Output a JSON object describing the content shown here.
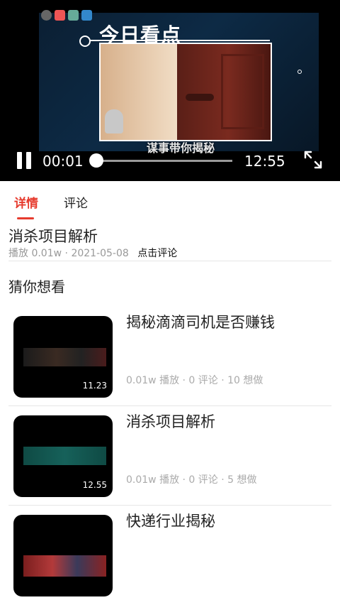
{
  "player": {
    "overlay_title": "今日看点",
    "subtitle": "谋事带你揭秘",
    "current_time": "00:01",
    "total_time": "12:55",
    "progress": 0.0
  },
  "tabs": [
    {
      "label": "详情"
    },
    {
      "label": "评论"
    }
  ],
  "detail": {
    "title": "消杀项目解析",
    "play_count": "播放 0.01w",
    "separator": "·",
    "date": "2021-05-08",
    "comment_link": "点击评论"
  },
  "section_title": "猜你想看",
  "recommendations": [
    {
      "title": "揭秘滴滴司机是否赚钱",
      "duration": "11.23",
      "meta": "0.01w 播放 · 0 评论 · 10 想做"
    },
    {
      "title": "消杀项目解析",
      "duration": "12.55",
      "meta": "0.01w 播放 · 0 评论 · 5 想做"
    },
    {
      "title": "快递行业揭秘",
      "duration": "",
      "meta": ""
    }
  ],
  "colors": {
    "accent": "#e63b2e"
  }
}
